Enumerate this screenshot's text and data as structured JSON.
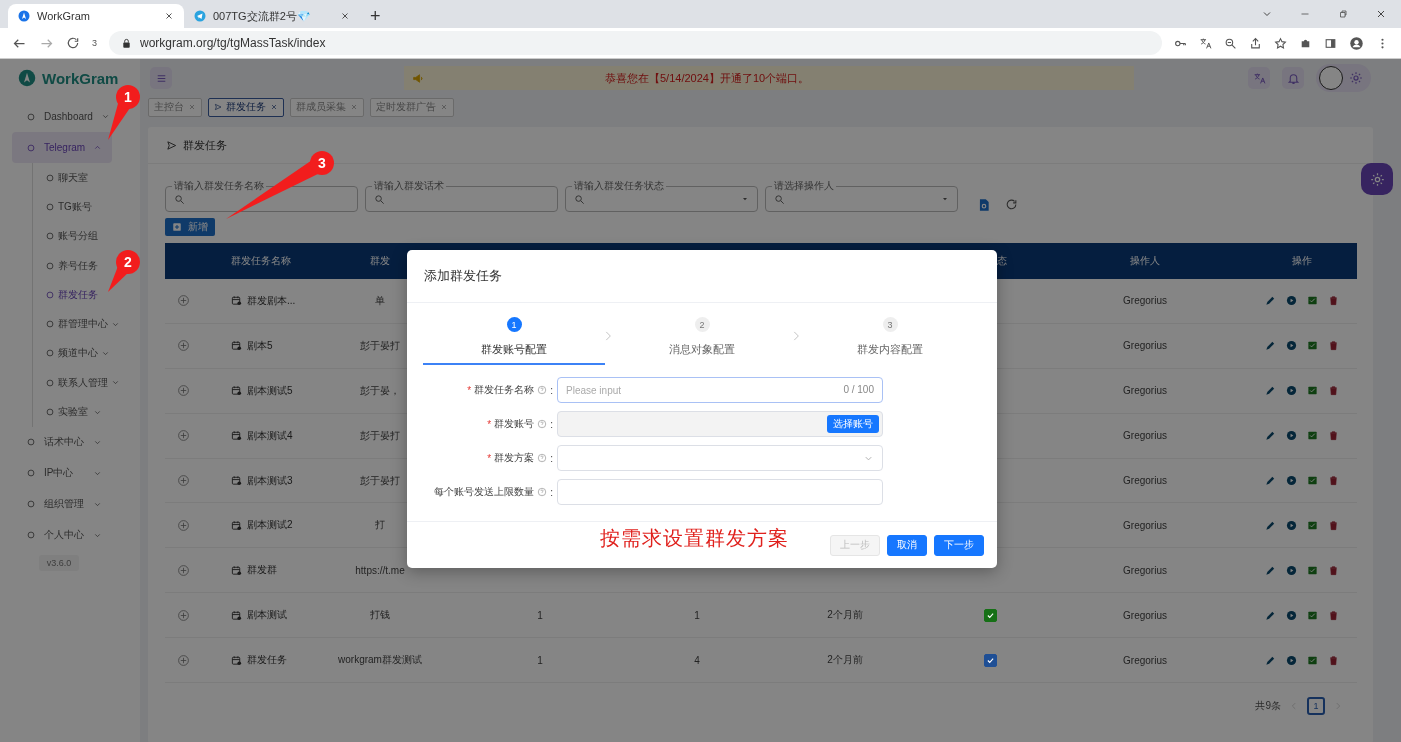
{
  "browser": {
    "tabs": [
      {
        "title": "WorkGram",
        "selected": true
      },
      {
        "title": "007TG交流群2号💎",
        "selected": false
      }
    ],
    "new_tab": "+",
    "badge": "3",
    "address": "workgram.org/tg/tgMassTask/index"
  },
  "app": {
    "logo": "WorkGram",
    "notice": "恭喜您在【5/14/2024】开通了10个端口。"
  },
  "tags": [
    {
      "label": "主控台",
      "selected": false
    },
    {
      "label": "群发任务",
      "selected": true
    },
    {
      "label": "群成员采集",
      "selected": false
    },
    {
      "label": "定时发群广告",
      "selected": false
    }
  ],
  "sidebar": {
    "items": [
      {
        "label": "Dashboard",
        "kind": "group",
        "expanded": false,
        "selected": false
      },
      {
        "label": "Telegram",
        "kind": "group",
        "expanded": true,
        "selected": true,
        "children": [
          {
            "label": "聊天室",
            "kind": "link",
            "selected": false
          },
          {
            "label": "TG账号",
            "kind": "link",
            "selected": false
          },
          {
            "label": "账号分组",
            "kind": "link",
            "selected": false
          },
          {
            "label": "养号任务",
            "kind": "link",
            "selected": false
          },
          {
            "label": "群发任务",
            "kind": "link",
            "selected": true
          },
          {
            "label": "群管理中心",
            "kind": "group",
            "expanded": false,
            "selected": false
          },
          {
            "label": "频道中心",
            "kind": "group",
            "expanded": false,
            "selected": false
          },
          {
            "label": "联系人管理",
            "kind": "group",
            "expanded": false,
            "selected": false
          },
          {
            "label": "实验室",
            "kind": "group",
            "expanded": false,
            "selected": false
          }
        ]
      },
      {
        "label": "话术中心",
        "kind": "group",
        "expanded": false,
        "selected": false
      },
      {
        "label": "IP中心",
        "kind": "group",
        "expanded": false,
        "selected": false
      },
      {
        "label": "组织管理",
        "kind": "group",
        "expanded": false,
        "selected": false
      },
      {
        "label": "个人中心",
        "kind": "group",
        "expanded": false,
        "selected": false
      }
    ],
    "version": "v3.6.0"
  },
  "page": {
    "title": "群发任务",
    "filters": [
      {
        "label": "请输入群发任务名称",
        "kind": "text"
      },
      {
        "label": "请输入群发话术",
        "kind": "text"
      },
      {
        "label": "请输入群发任务状态",
        "kind": "select"
      },
      {
        "label": "请选择操作人",
        "kind": "select"
      }
    ],
    "add_button": "新增"
  },
  "table": {
    "columns": [
      {
        "label": "群发任务名称"
      },
      {
        "label": "群发"
      },
      {
        "label": "态"
      },
      {
        "label": "操作人"
      },
      {
        "label": "操作"
      }
    ],
    "rows": [
      {
        "name": "群发剧本...",
        "content": "单",
        "operator": "Gregorius"
      },
      {
        "name": "剧本5",
        "content": "彭于晏打",
        "operator": "Gregorius"
      },
      {
        "name": "剧本测试5",
        "content": "彭于晏，",
        "operator": "Gregorius"
      },
      {
        "name": "剧本测试4",
        "content": "彭于晏打",
        "operator": "Gregorius"
      },
      {
        "name": "剧本测试3",
        "content": "彭于晏打",
        "operator": "Gregorius"
      },
      {
        "name": "剧本测试2",
        "content": "打",
        "operator": "Gregorius"
      },
      {
        "name": "群发群",
        "content": "https://t.me",
        "operator": "Gregorius"
      },
      {
        "name": "剧本测试",
        "content": "打钱",
        "column_3": "1",
        "column_4": "1",
        "column_5": "2个月前",
        "status": {
          "checked": true,
          "color": "#167016"
        },
        "operator": "Gregorius"
      },
      {
        "name": "群发任务",
        "content": "workgram群发测试",
        "column_3": "1",
        "column_4": "4",
        "column_5": "2个月前",
        "status": {
          "checked": true,
          "color": "#1f4f95"
        },
        "operator": "Gregorius"
      }
    ]
  },
  "pagination": {
    "total": "共9条",
    "pages": [
      {
        "label": "1",
        "selected": true
      }
    ]
  },
  "dialog": {
    "title": "添加群发任务",
    "steps": [
      {
        "number": "1",
        "label": "群发账号配置",
        "selected": true
      },
      {
        "number": "2",
        "label": "消息对象配置",
        "selected": false
      },
      {
        "number": "3",
        "label": "群发内容配置",
        "selected": false
      }
    ],
    "fields": [
      {
        "label": "群发任务名称",
        "required_mark": "*",
        "separator": ":",
        "kind": "text",
        "placeholder": "Please input",
        "counter": "0 / 100"
      },
      {
        "label": "群发账号",
        "required_mark": "*",
        "separator": ":",
        "kind": "picker",
        "button": "选择账号"
      },
      {
        "label": "群发方案",
        "required_mark": "*",
        "separator": ":",
        "kind": "select"
      },
      {
        "label": "每个账号发送上限数量",
        "separator": ":",
        "kind": "text"
      }
    ],
    "note": "按需求设置群发方案",
    "buttons": [
      {
        "label": "上一步",
        "kind": "default",
        "disabled": true
      },
      {
        "label": "取消",
        "kind": "primary",
        "disabled": false
      },
      {
        "label": "下一步",
        "kind": "primary",
        "disabled": false
      }
    ]
  },
  "callouts": [
    {
      "label": "1"
    },
    {
      "label": "2"
    },
    {
      "label": "3"
    }
  ]
}
